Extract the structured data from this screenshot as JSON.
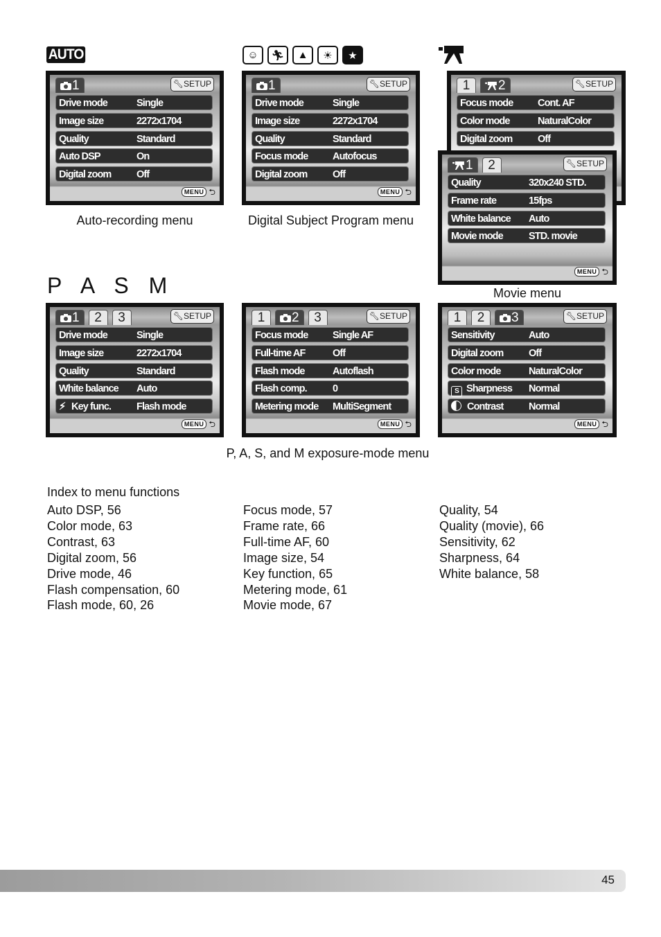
{
  "headers": {
    "auto_badge": "AUTO",
    "scene_icons": [
      "portrait-icon",
      "sports-icon",
      "landscape-icon",
      "sunset-icon",
      "night-portrait-icon"
    ],
    "movie_icon": "movie-camera-icon",
    "pasm_label": "P A S M"
  },
  "screens": {
    "auto": {
      "tabs": [
        {
          "label": "1",
          "icon": "camera-icon",
          "active": true
        }
      ],
      "setup_label": "SETUP",
      "rows": [
        {
          "label": "Drive mode",
          "value": "Single"
        },
        {
          "label": "Image size",
          "value": "2272x1704"
        },
        {
          "label": "Quality",
          "value": "Standard"
        },
        {
          "label": "Auto DSP",
          "value": "On"
        },
        {
          "label": "Digital zoom",
          "value": "Off"
        }
      ],
      "menu_label": "MENU"
    },
    "dsp": {
      "tabs": [
        {
          "label": "1",
          "icon": "camera-icon",
          "active": true
        }
      ],
      "setup_label": "SETUP",
      "rows": [
        {
          "label": "Drive mode",
          "value": "Single"
        },
        {
          "label": "Image size",
          "value": "2272x1704"
        },
        {
          "label": "Quality",
          "value": "Standard"
        },
        {
          "label": "Focus mode",
          "value": "Autofocus"
        },
        {
          "label": "Digital zoom",
          "value": "Off"
        }
      ],
      "menu_label": "MENU"
    },
    "movie2": {
      "tabs": [
        {
          "label": "1",
          "active": false
        },
        {
          "label": "2",
          "icon": "movie-icon",
          "active": true
        }
      ],
      "setup_label": "SETUP",
      "rows": [
        {
          "label": "Focus mode",
          "value": "Cont. AF"
        },
        {
          "label": "Color mode",
          "value": "NaturalColor"
        },
        {
          "label": "Digital zoom",
          "value": "Off"
        }
      ]
    },
    "movie1": {
      "tabs": [
        {
          "label": "1",
          "icon": "movie-icon",
          "active": true
        },
        {
          "label": "2",
          "active": false
        }
      ],
      "setup_label": "SETUP",
      "rows": [
        {
          "label": "Quality",
          "value": "320x240 STD."
        },
        {
          "label": "Frame rate",
          "value": "15fps"
        },
        {
          "label": "White balance",
          "value": "Auto"
        },
        {
          "label": "Movie mode",
          "value": "STD. movie"
        }
      ],
      "menu_label": "MENU"
    },
    "pasm1": {
      "tabs": [
        {
          "label": "1",
          "icon": "camera-icon",
          "active": true
        },
        {
          "label": "2",
          "active": false
        },
        {
          "label": "3",
          "active": false
        }
      ],
      "setup_label": "SETUP",
      "rows": [
        {
          "label": "Drive mode",
          "value": "Single"
        },
        {
          "label": "Image size",
          "value": "2272x1704"
        },
        {
          "label": "Quality",
          "value": "Standard"
        },
        {
          "label": "White balance",
          "value": "Auto"
        },
        {
          "label": "Key func.",
          "value": "Flash mode",
          "icon": "flash-icon"
        }
      ],
      "menu_label": "MENU"
    },
    "pasm2": {
      "tabs": [
        {
          "label": "1",
          "active": false
        },
        {
          "label": "2",
          "icon": "camera-icon",
          "active": true
        },
        {
          "label": "3",
          "active": false
        }
      ],
      "setup_label": "SETUP",
      "rows": [
        {
          "label": "Focus mode",
          "value": "Single AF"
        },
        {
          "label": "Full-time AF",
          "value": "Off"
        },
        {
          "label": "Flash mode",
          "value": "Autoflash"
        },
        {
          "label": "Flash comp.",
          "value": "0"
        },
        {
          "label": "Metering mode",
          "value": "MultiSegment"
        }
      ],
      "menu_label": "MENU"
    },
    "pasm3": {
      "tabs": [
        {
          "label": "1",
          "active": false
        },
        {
          "label": "2",
          "active": false
        },
        {
          "label": "3",
          "icon": "camera-icon",
          "active": true
        }
      ],
      "setup_label": "SETUP",
      "rows": [
        {
          "label": "Sensitivity",
          "value": "Auto"
        },
        {
          "label": "Digital zoom",
          "value": "Off"
        },
        {
          "label": "Color mode",
          "value": "NaturalColor"
        },
        {
          "label": "Sharpness",
          "value": "Normal",
          "icon": "sharpness-icon"
        },
        {
          "label": "Contrast",
          "value": "Normal",
          "icon": "contrast-icon"
        }
      ],
      "menu_label": "MENU"
    }
  },
  "captions": {
    "auto": "Auto-recording menu",
    "dsp": "Digital Subject Program menu",
    "movie": "Movie menu",
    "pasm": "P, A, S, and M exposure-mode menu"
  },
  "index": {
    "title": "Index to menu functions",
    "columns": [
      [
        "Auto DSP, 56",
        "Color mode, 63",
        "Contrast, 63",
        "Digital zoom, 56",
        "Drive mode, 46",
        "Flash compensation, 60",
        "Flash mode, 60, 26"
      ],
      [
        "Focus mode, 57",
        "Frame rate, 66",
        "Full-time AF, 60",
        "Image size, 54",
        "Key function, 65",
        "Metering mode, 61",
        "Movie mode, 67"
      ],
      [
        "Quality, 54",
        "Quality (movie), 66",
        "Sensitivity, 62",
        "Sharpness, 64",
        "White balance, 58"
      ]
    ]
  },
  "footer": {
    "page_number": "45"
  }
}
